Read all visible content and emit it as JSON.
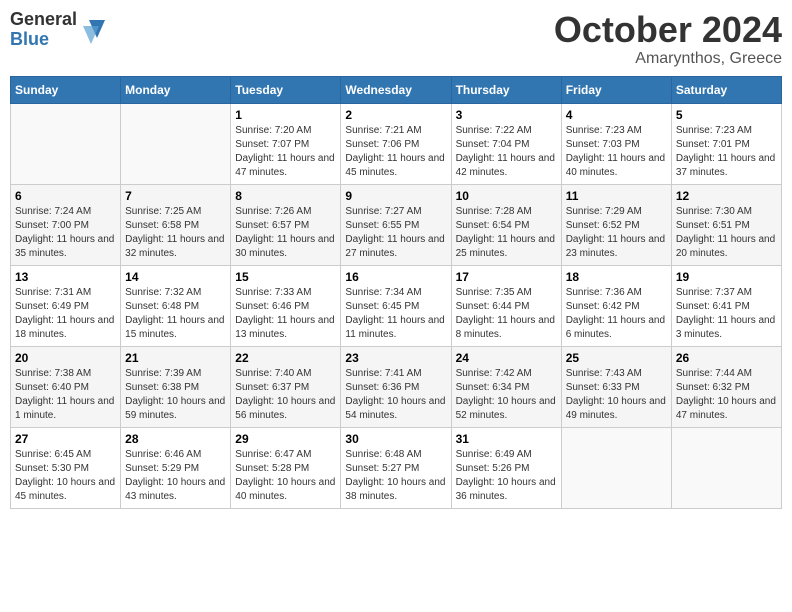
{
  "header": {
    "logo_line1": "General",
    "logo_line2": "Blue",
    "month": "October 2024",
    "location": "Amarynthos, Greece"
  },
  "weekdays": [
    "Sunday",
    "Monday",
    "Tuesday",
    "Wednesday",
    "Thursday",
    "Friday",
    "Saturday"
  ],
  "weeks": [
    [
      {
        "day": "",
        "info": ""
      },
      {
        "day": "",
        "info": ""
      },
      {
        "day": "1",
        "info": "Sunrise: 7:20 AM\nSunset: 7:07 PM\nDaylight: 11 hours and 47 minutes."
      },
      {
        "day": "2",
        "info": "Sunrise: 7:21 AM\nSunset: 7:06 PM\nDaylight: 11 hours and 45 minutes."
      },
      {
        "day": "3",
        "info": "Sunrise: 7:22 AM\nSunset: 7:04 PM\nDaylight: 11 hours and 42 minutes."
      },
      {
        "day": "4",
        "info": "Sunrise: 7:23 AM\nSunset: 7:03 PM\nDaylight: 11 hours and 40 minutes."
      },
      {
        "day": "5",
        "info": "Sunrise: 7:23 AM\nSunset: 7:01 PM\nDaylight: 11 hours and 37 minutes."
      }
    ],
    [
      {
        "day": "6",
        "info": "Sunrise: 7:24 AM\nSunset: 7:00 PM\nDaylight: 11 hours and 35 minutes."
      },
      {
        "day": "7",
        "info": "Sunrise: 7:25 AM\nSunset: 6:58 PM\nDaylight: 11 hours and 32 minutes."
      },
      {
        "day": "8",
        "info": "Sunrise: 7:26 AM\nSunset: 6:57 PM\nDaylight: 11 hours and 30 minutes."
      },
      {
        "day": "9",
        "info": "Sunrise: 7:27 AM\nSunset: 6:55 PM\nDaylight: 11 hours and 27 minutes."
      },
      {
        "day": "10",
        "info": "Sunrise: 7:28 AM\nSunset: 6:54 PM\nDaylight: 11 hours and 25 minutes."
      },
      {
        "day": "11",
        "info": "Sunrise: 7:29 AM\nSunset: 6:52 PM\nDaylight: 11 hours and 23 minutes."
      },
      {
        "day": "12",
        "info": "Sunrise: 7:30 AM\nSunset: 6:51 PM\nDaylight: 11 hours and 20 minutes."
      }
    ],
    [
      {
        "day": "13",
        "info": "Sunrise: 7:31 AM\nSunset: 6:49 PM\nDaylight: 11 hours and 18 minutes."
      },
      {
        "day": "14",
        "info": "Sunrise: 7:32 AM\nSunset: 6:48 PM\nDaylight: 11 hours and 15 minutes."
      },
      {
        "day": "15",
        "info": "Sunrise: 7:33 AM\nSunset: 6:46 PM\nDaylight: 11 hours and 13 minutes."
      },
      {
        "day": "16",
        "info": "Sunrise: 7:34 AM\nSunset: 6:45 PM\nDaylight: 11 hours and 11 minutes."
      },
      {
        "day": "17",
        "info": "Sunrise: 7:35 AM\nSunset: 6:44 PM\nDaylight: 11 hours and 8 minutes."
      },
      {
        "day": "18",
        "info": "Sunrise: 7:36 AM\nSunset: 6:42 PM\nDaylight: 11 hours and 6 minutes."
      },
      {
        "day": "19",
        "info": "Sunrise: 7:37 AM\nSunset: 6:41 PM\nDaylight: 11 hours and 3 minutes."
      }
    ],
    [
      {
        "day": "20",
        "info": "Sunrise: 7:38 AM\nSunset: 6:40 PM\nDaylight: 11 hours and 1 minute."
      },
      {
        "day": "21",
        "info": "Sunrise: 7:39 AM\nSunset: 6:38 PM\nDaylight: 10 hours and 59 minutes."
      },
      {
        "day": "22",
        "info": "Sunrise: 7:40 AM\nSunset: 6:37 PM\nDaylight: 10 hours and 56 minutes."
      },
      {
        "day": "23",
        "info": "Sunrise: 7:41 AM\nSunset: 6:36 PM\nDaylight: 10 hours and 54 minutes."
      },
      {
        "day": "24",
        "info": "Sunrise: 7:42 AM\nSunset: 6:34 PM\nDaylight: 10 hours and 52 minutes."
      },
      {
        "day": "25",
        "info": "Sunrise: 7:43 AM\nSunset: 6:33 PM\nDaylight: 10 hours and 49 minutes."
      },
      {
        "day": "26",
        "info": "Sunrise: 7:44 AM\nSunset: 6:32 PM\nDaylight: 10 hours and 47 minutes."
      }
    ],
    [
      {
        "day": "27",
        "info": "Sunrise: 6:45 AM\nSunset: 5:30 PM\nDaylight: 10 hours and 45 minutes."
      },
      {
        "day": "28",
        "info": "Sunrise: 6:46 AM\nSunset: 5:29 PM\nDaylight: 10 hours and 43 minutes."
      },
      {
        "day": "29",
        "info": "Sunrise: 6:47 AM\nSunset: 5:28 PM\nDaylight: 10 hours and 40 minutes."
      },
      {
        "day": "30",
        "info": "Sunrise: 6:48 AM\nSunset: 5:27 PM\nDaylight: 10 hours and 38 minutes."
      },
      {
        "day": "31",
        "info": "Sunrise: 6:49 AM\nSunset: 5:26 PM\nDaylight: 10 hours and 36 minutes."
      },
      {
        "day": "",
        "info": ""
      },
      {
        "day": "",
        "info": ""
      }
    ]
  ]
}
